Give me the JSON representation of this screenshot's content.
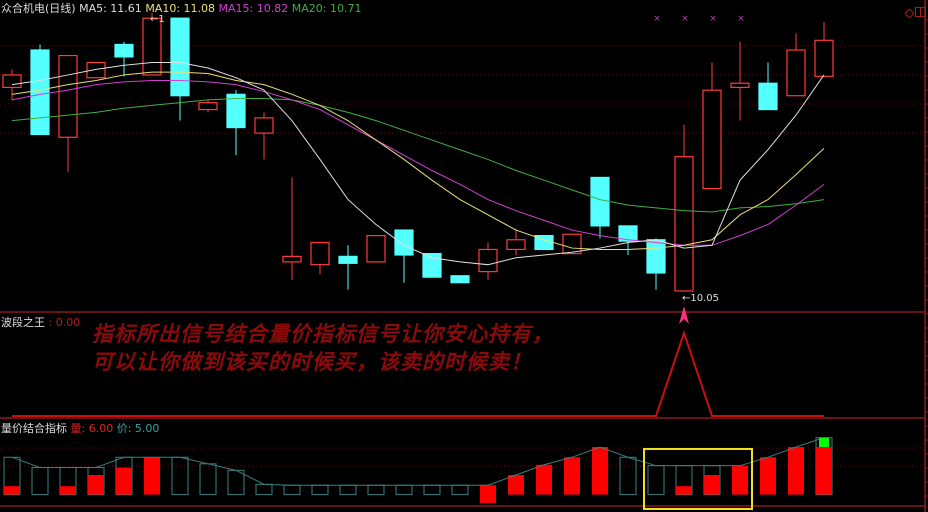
{
  "header": {
    "title": "众合机电(日线)",
    "ma5": "MA5: 11.61",
    "ma10": "MA10: 11.08",
    "ma15": "MA15: 10.82",
    "ma20": "MA20: 10.71"
  },
  "colors": {
    "up": "#ff3b3b",
    "down": "#54ffff",
    "ma5": "#e0e0e0",
    "ma10": "#e8e07a",
    "ma15": "#d040d0",
    "ma20": "#40b040",
    "frame": "#8b1a1a",
    "signal": "#c81010",
    "highlight": "#f0e020"
  },
  "price_labels": {
    "low_marker": "←10.05",
    "high_marker": "←1"
  },
  "wave_panel": {
    "title": "波段之王",
    "value": ": 0.00",
    "slogan_line1": "指标所出信号结合量价指标信号让你安心持有，",
    "slogan_line2": "可以让你做到该买的时候买，该卖的时候卖！"
  },
  "vp_panel": {
    "title": "量价结合指标",
    "vol_label": "量: 6.00",
    "price_label": "价: 5.00"
  },
  "chart_data": {
    "type": "candlestick",
    "ohlc": [
      [
        11.52,
        11.65,
        11.43,
        11.61
      ],
      [
        11.79,
        11.83,
        11.18,
        11.18
      ],
      [
        11.16,
        11.75,
        10.91,
        11.75
      ],
      [
        11.59,
        11.7,
        11.59,
        11.7
      ],
      [
        11.83,
        11.85,
        11.6,
        11.74
      ],
      [
        11.61,
        12.06,
        11.61,
        12.02
      ],
      [
        12.02,
        12.02,
        11.28,
        11.46
      ],
      [
        11.36,
        11.43,
        11.34,
        11.41
      ],
      [
        11.47,
        11.5,
        11.03,
        11.23
      ],
      [
        11.19,
        11.34,
        11.0,
        11.3
      ],
      [
        10.26,
        10.87,
        10.13,
        10.3
      ],
      [
        10.24,
        10.4,
        10.17,
        10.4
      ],
      [
        10.3,
        10.38,
        10.06,
        10.25
      ],
      [
        10.26,
        10.45,
        10.26,
        10.45
      ],
      [
        10.49,
        10.49,
        10.11,
        10.31
      ],
      [
        10.32,
        10.32,
        10.15,
        10.15
      ],
      [
        10.16,
        10.16,
        10.11,
        10.11
      ],
      [
        10.19,
        10.4,
        10.13,
        10.35
      ],
      [
        10.35,
        10.5,
        10.31,
        10.42
      ],
      [
        10.45,
        10.45,
        10.35,
        10.35
      ],
      [
        10.32,
        10.46,
        10.32,
        10.46
      ],
      [
        10.87,
        10.87,
        10.43,
        10.52
      ],
      [
        10.52,
        10.52,
        10.31,
        10.41
      ],
      [
        10.42,
        10.43,
        10.06,
        10.18
      ],
      [
        10.05,
        11.25,
        10.05,
        11.02
      ],
      [
        10.79,
        11.7,
        10.79,
        11.5
      ],
      [
        11.52,
        11.85,
        11.28,
        11.55
      ],
      [
        11.55,
        11.7,
        11.36,
        11.36
      ],
      [
        11.46,
        11.91,
        11.46,
        11.79
      ],
      [
        11.6,
        11.99,
        11.6,
        11.86
      ]
    ],
    "ma5": [
      11.54,
      11.57,
      11.61,
      11.65,
      11.68,
      11.7,
      11.7,
      11.66,
      11.59,
      11.5,
      11.28,
      11.0,
      10.71,
      10.53,
      10.38,
      10.29,
      10.26,
      10.24,
      10.29,
      10.31,
      10.33,
      10.36,
      10.4,
      10.42,
      10.36,
      10.38,
      10.85,
      11.07,
      11.32,
      11.61
    ],
    "ma10": [
      11.47,
      11.5,
      11.54,
      11.57,
      11.61,
      11.63,
      11.63,
      11.62,
      11.57,
      11.54,
      11.47,
      11.39,
      11.28,
      11.14,
      11.0,
      10.85,
      10.71,
      10.6,
      10.49,
      10.42,
      10.36,
      10.35,
      10.35,
      10.36,
      10.38,
      10.42,
      10.6,
      10.71,
      10.89,
      11.08
    ],
    "ma15": [
      11.43,
      11.47,
      11.5,
      11.54,
      11.56,
      11.57,
      11.57,
      11.56,
      11.54,
      11.49,
      11.43,
      11.36,
      11.25,
      11.14,
      11.03,
      10.92,
      10.82,
      10.71,
      10.63,
      10.56,
      10.49,
      10.45,
      10.42,
      10.4,
      10.38,
      10.38,
      10.45,
      10.53,
      10.67,
      10.82
    ],
    "ma20": [
      11.28,
      11.3,
      11.32,
      11.34,
      11.37,
      11.39,
      11.41,
      11.43,
      11.44,
      11.44,
      11.43,
      11.39,
      11.34,
      11.28,
      11.21,
      11.14,
      11.07,
      11.0,
      10.92,
      10.85,
      10.78,
      10.71,
      10.67,
      10.65,
      10.63,
      10.62,
      10.65,
      10.66,
      10.68,
      10.71
    ],
    "price_range": [
      10.05,
      12.06
    ],
    "markers_x_on": [
      23,
      24,
      25,
      26
    ],
    "wave_signal": [
      0,
      0,
      0,
      0,
      0,
      0,
      0,
      0,
      0,
      0,
      0,
      0,
      0,
      0,
      0,
      0,
      0,
      0,
      0,
      0,
      0,
      0,
      0,
      0,
      1,
      0,
      0,
      0,
      0,
      0
    ],
    "vp_bars": [
      [
        4.9,
        0.9,
        1.8
      ],
      [
        3.8,
        0.9,
        null
      ],
      [
        3.8,
        0.9,
        1.8
      ],
      [
        3.8,
        0.9,
        3.0
      ],
      [
        4.9,
        0.9,
        3.8
      ],
      [
        4.9,
        0.9,
        4.9
      ],
      [
        4.9,
        0.9,
        null
      ],
      [
        4.2,
        0.9,
        null
      ],
      [
        3.5,
        0.9,
        null
      ],
      [
        2.0,
        0.9,
        null
      ],
      [
        1.9,
        0.9,
        null
      ],
      [
        1.9,
        0.9,
        null
      ],
      [
        1.9,
        0.9,
        null
      ],
      [
        1.9,
        0.9,
        null
      ],
      [
        1.9,
        0.9,
        null
      ],
      [
        1.9,
        0.9,
        null
      ],
      [
        1.9,
        0.9,
        null
      ],
      [
        1.9,
        0.0,
        1.9
      ],
      [
        3.0,
        0.9,
        3.0
      ],
      [
        4.1,
        0.9,
        4.1
      ],
      [
        4.9,
        0.9,
        4.9
      ],
      [
        6.0,
        0.9,
        6.0
      ],
      [
        4.9,
        0.9,
        null
      ],
      [
        4.0,
        0.9,
        null
      ],
      [
        4.0,
        0.9,
        1.8
      ],
      [
        4.0,
        0.9,
        3.0
      ],
      [
        4.0,
        0.9,
        4.0
      ],
      [
        4.9,
        0.9,
        4.9
      ],
      [
        6.0,
        0.9,
        6.0
      ],
      [
        7.0,
        0.9,
        6.0
      ]
    ],
    "vp_green_top_index": 29,
    "highlight_range": [
      23,
      25
    ]
  }
}
